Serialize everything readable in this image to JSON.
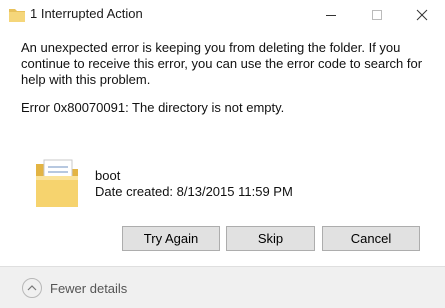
{
  "window": {
    "title": "1 Interrupted Action",
    "controls": {
      "minimize": "minimize-icon",
      "maximize": "maximize-icon",
      "close": "close-icon"
    }
  },
  "dialog": {
    "message": "An unexpected error is keeping you from deleting the folder. If you continue to receive this error, you can use the error code to search for help with this problem.",
    "error": "Error 0x80070091: The directory is not empty.",
    "item": {
      "icon": "folder-icon",
      "name": "boot",
      "date_created": "Date created: 8/13/2015 11:59 PM"
    },
    "buttons": {
      "try_again": "Try Again",
      "skip": "Skip",
      "cancel": "Cancel"
    }
  },
  "footer": {
    "details_label": "Fewer details",
    "details_icon": "chevron-up-icon"
  }
}
